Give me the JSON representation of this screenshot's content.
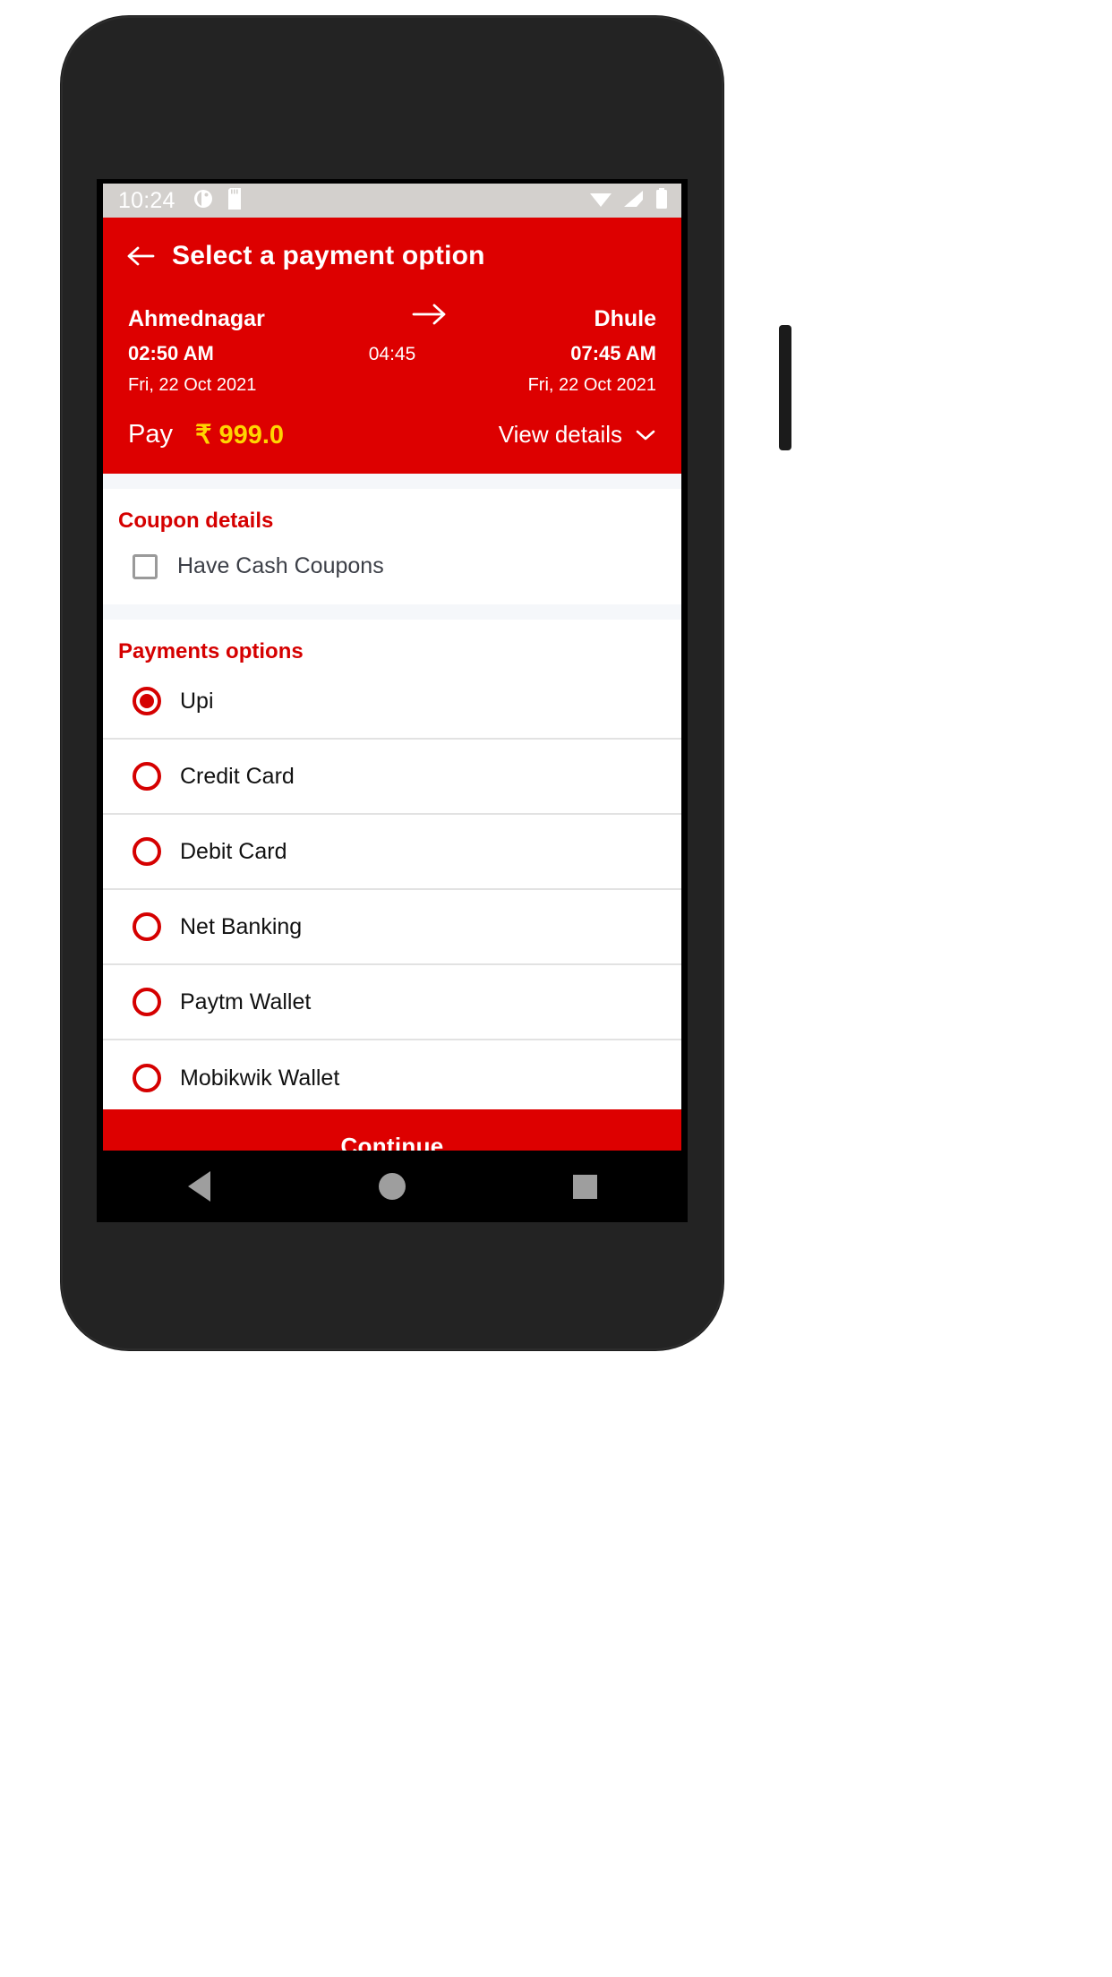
{
  "status_bar": {
    "time": "10:24",
    "left_icons": [
      "location-icon",
      "sd-card-icon"
    ],
    "right_icons": [
      "wifi-icon",
      "signal-icon",
      "battery-icon"
    ]
  },
  "app_bar": {
    "back_icon": "arrow-left-icon",
    "title": "Select a payment option"
  },
  "journey": {
    "origin_city": "Ahmednagar",
    "origin_time": "02:50 AM",
    "origin_date": "Fri, 22 Oct 2021",
    "duration": "04:45",
    "arrow_icon": "arrow-right-icon",
    "destination_city": "Dhule",
    "destination_time": "07:45 AM",
    "destination_date": "Fri, 22 Oct 2021"
  },
  "fare": {
    "pay_label": "Pay",
    "amount": "₹ 999.0",
    "view_details_label": "View details",
    "chevron_icon": "chevron-down-icon"
  },
  "coupon": {
    "section_title": "Coupon details",
    "checkbox_label": "Have Cash Coupons",
    "checked": false
  },
  "payments": {
    "section_title": "Payments options",
    "options": [
      {
        "label": "Upi",
        "selected": true
      },
      {
        "label": "Credit Card",
        "selected": false
      },
      {
        "label": "Debit Card",
        "selected": false
      },
      {
        "label": "Net Banking",
        "selected": false
      },
      {
        "label": "Paytm Wallet",
        "selected": false
      },
      {
        "label": "Mobikwik Wallet",
        "selected": false
      }
    ]
  },
  "footer": {
    "continue_label": "Continue"
  },
  "nav_bar": {
    "back_icon": "triangle-back-icon",
    "home_icon": "circle-home-icon",
    "recents_icon": "square-recents-icon"
  },
  "colors": {
    "brand_red": "#dd0000",
    "accent_yellow": "#ffd400",
    "section_title_red": "#d50000",
    "status_bar_grey": "#d3d0cd"
  }
}
